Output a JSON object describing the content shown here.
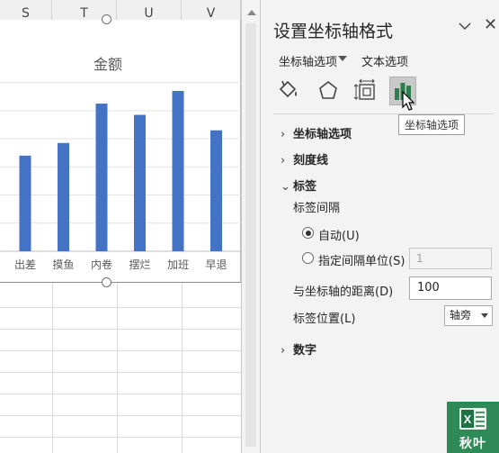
{
  "sheet": {
    "columns": [
      "S",
      "T",
      "U",
      "V"
    ]
  },
  "chart_data": {
    "type": "bar",
    "title": "金额",
    "categories": [
      "出差",
      "摸鱼",
      "内卷",
      "摆烂",
      "加班",
      "早退"
    ],
    "values": [
      68,
      77,
      105,
      97,
      114,
      86
    ],
    "ylim": [
      0,
      130
    ],
    "grid": true,
    "bar_color": "#4472c4"
  },
  "pane": {
    "title": "设置坐标轴格式",
    "tab_axis_options": "坐标轴选项",
    "tab_text_options": "文本选项",
    "tooltip": "坐标轴选项",
    "sections": {
      "axis_options": "坐标轴选项",
      "tick_marks": "刻度线",
      "labels": "标签",
      "number": "数字"
    },
    "labels": {
      "interval_heading": "标签间隔",
      "auto": "自动(U)",
      "specify_unit": "指定间隔单位(S)",
      "unit_value": "1",
      "distance_label": "与坐标轴的距离(D)",
      "distance_value": "100",
      "position_label": "标签位置(L)",
      "position_value": "轴旁"
    }
  },
  "logo": {
    "text": "秋叶"
  },
  "colors": {
    "accent_green": "#2e8b57",
    "bar_blue": "#4472c4"
  }
}
